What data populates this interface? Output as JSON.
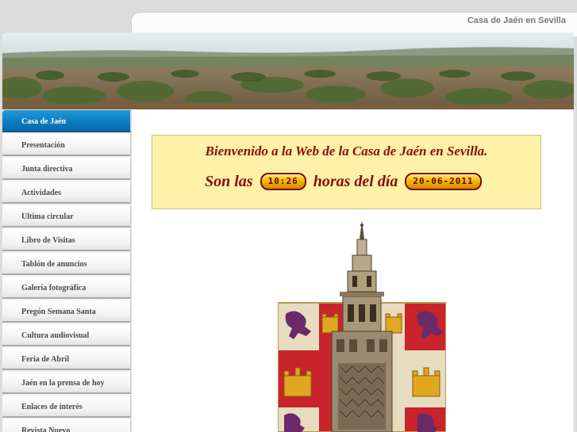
{
  "header": {
    "site_name": "Casa de Jaén en Sevilla"
  },
  "sidebar": {
    "items": [
      {
        "label": "Casa de Jaén",
        "active": true
      },
      {
        "label": "Presentación"
      },
      {
        "label": "Junta directiva"
      },
      {
        "label": "Actividades"
      },
      {
        "label": "Ultima circular"
      },
      {
        "label": "Libro de Visitas"
      },
      {
        "label": "Tablón de anuncios"
      },
      {
        "label": "Galería fotográfica"
      },
      {
        "label": "Pregón Semana Santa"
      },
      {
        "label": "Cultura audiovisual"
      },
      {
        "label": "Feria de Abril"
      },
      {
        "label": "Jaén en la prensa de hoy"
      },
      {
        "label": "Enlaces de interés"
      },
      {
        "label": "Revista Nuevo"
      }
    ]
  },
  "welcome": {
    "title": "Bienvenido a la Web de la Casa de Jaén en Sevilla.",
    "prefix": "Son las",
    "time": "10:26",
    "middle": "horas del día",
    "date": "20-06-2011"
  },
  "colors": {
    "accent": "#0d7cc2",
    "welcome_bg": "#fff2a8",
    "welcome_text": "#8b0c0c"
  },
  "icons": {
    "banner": "olive-grove-landscape-image",
    "emblem": "giralda-tower-coat-of-arms-image"
  }
}
